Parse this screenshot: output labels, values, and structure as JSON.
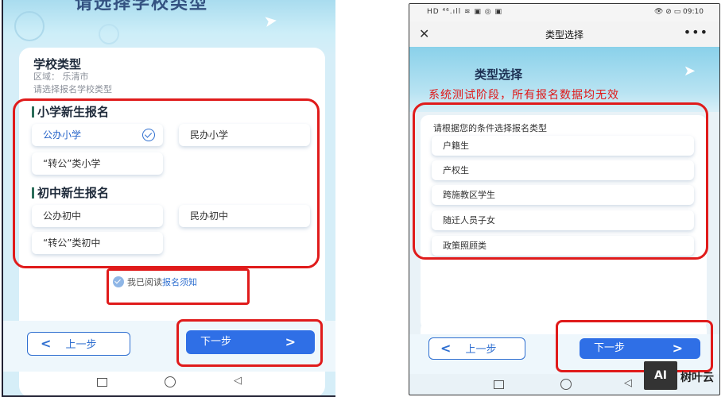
{
  "left": {
    "header_title": "请选择学校类型",
    "school_type_title": "学校类型",
    "region_text": "区域：  乐清市",
    "hint_text": "请选择报名学校类型",
    "primary_section": "小学新生报名",
    "primary_options": [
      "公办小学",
      "民办小学",
      "“转公”类小学"
    ],
    "middle_section": "初中新生报名",
    "middle_options": [
      "公办初中",
      "民办初中",
      "“转公”类初中"
    ],
    "agree_prefix": "我已阅读",
    "agree_link": "报名须知",
    "prev_label": "上一步",
    "next_label": "下一步",
    "prev_icon": "chevron-left",
    "next_icon": "chevron-right"
  },
  "right": {
    "status_left": "HD ⁴⁶.ıll ≋ ▣ ◎ ▣",
    "status_right": "👁 ⊘ ▭ 09:10",
    "page_title": "类型选择",
    "hero_title": "类型选择",
    "warning": "系统测试阶段，所有报名数据均无效",
    "hint": "请根据您的条件选择报名类型",
    "options": [
      "户籍生",
      "产权生",
      "跨施教区学生",
      "随迁人员子女",
      "政策照顾类"
    ],
    "prev_label": "上一步",
    "next_label": "下一步"
  },
  "watermark": {
    "logo": "AI",
    "text": "树叶云"
  },
  "colors": {
    "accent": "#2f6fe6",
    "highlight_box": "#e01b1b",
    "warning": "#e11717"
  }
}
